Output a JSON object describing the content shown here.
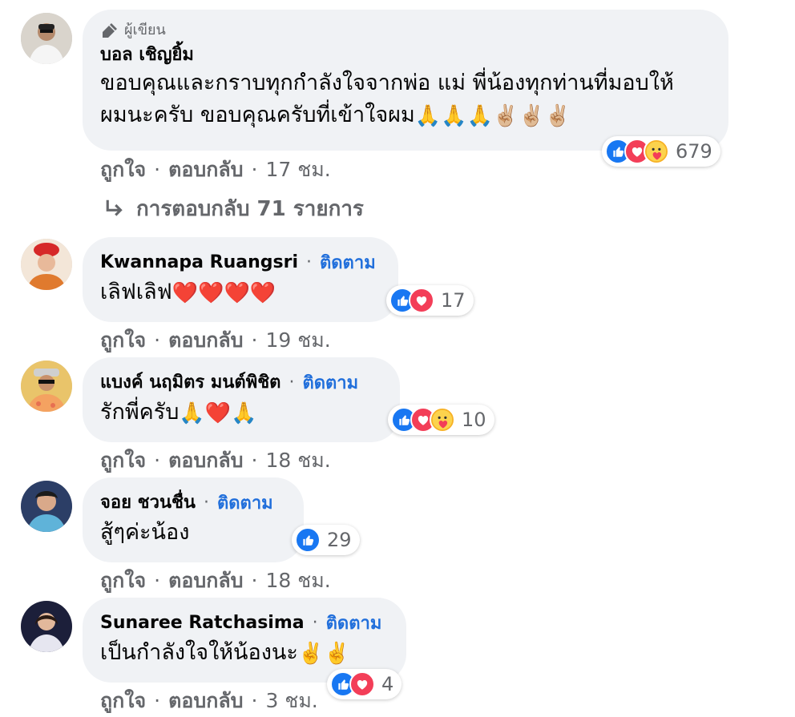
{
  "comments": [
    {
      "badge": "ผู้เขียน",
      "author": "บอล เชิญยิ้ม",
      "text_line1": "ขอบคุณและกราบทุกกำลังใจจากพ่อ แม่ พี่น้องทุกท่านที่มอบให้",
      "text_line2": "ผมนะครับ ขอบคุณครับที่เข้าใจผม",
      "emojis": "🙏🙏🙏✌🏼✌🏼✌🏼",
      "like": "ถูกใจ",
      "reply": "ตอบกลับ",
      "time": "17 ชม.",
      "reaction_count": "679",
      "reactions": [
        "like-icon",
        "love-icon",
        "care-icon"
      ]
    },
    {
      "author": "Kwannapa Ruangsri",
      "follow": "ติดตาม",
      "text": "เลิฟเลิฟ",
      "emojis": "❤️❤️❤️❤️",
      "like": "ถูกใจ",
      "reply": "ตอบกลับ",
      "time": "19 ชม.",
      "reaction_count": "17",
      "reactions": [
        "like-icon",
        "love-icon"
      ]
    },
    {
      "author": "แบงค์ นฤมิตร มนต์พิชิต",
      "follow": "ติดตาม",
      "text": "รักพี่ครับ",
      "emojis": "🙏❤️🙏",
      "like": "ถูกใจ",
      "reply": "ตอบกลับ",
      "time": "18 ชม.",
      "reaction_count": "10",
      "reactions": [
        "like-icon",
        "love-icon",
        "care-icon"
      ]
    },
    {
      "author": "จอย ชวนชื่น",
      "follow": "ติดตาม",
      "text": "สู้ๆค่ะน้อง",
      "like": "ถูกใจ",
      "reply": "ตอบกลับ",
      "time": "18 ชม.",
      "reaction_count": "29",
      "reactions": [
        "like-icon"
      ]
    },
    {
      "author": "Sunaree Ratchasima",
      "follow": "ติดตาม",
      "text": "เป็นกำลังใจให้น้องนะ",
      "emojis": "✌️✌️",
      "like": "ถูกใจ",
      "reply": "ตอบกลับ",
      "time": "3 ชม.",
      "reaction_count": "4",
      "reactions": [
        "like-icon",
        "love-icon"
      ]
    }
  ],
  "replies_link": "การตอบกลับ 71 รายการ",
  "colors": {
    "bubble": "#f0f2f5",
    "link": "#216fdb",
    "muted": "#65676b",
    "like": "#1877f2",
    "love": "#f33e58"
  }
}
